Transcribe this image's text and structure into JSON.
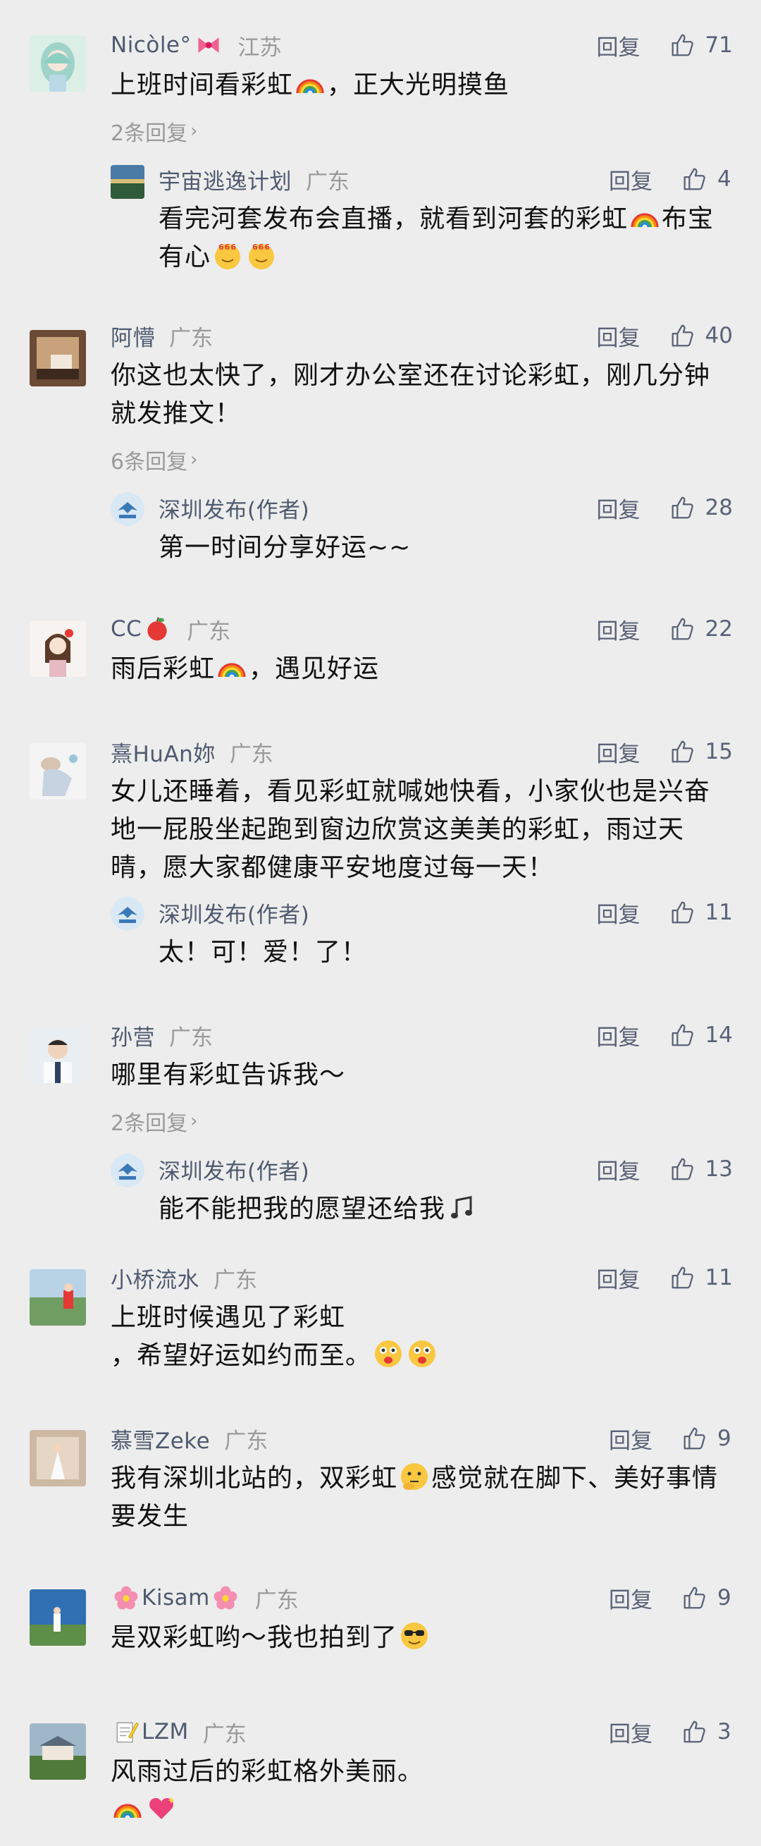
{
  "labels": {
    "reply": "回复"
  },
  "colors": {
    "background": "#ededed",
    "name": "#4f5a70",
    "meta": "#9a9a9a"
  },
  "comments": [
    {
      "name": "Nicòle°",
      "name_emoji": "bow",
      "location": "江苏",
      "likes": "71",
      "text_parts": [
        "上班时间看彩虹",
        "，正大光明摸鱼"
      ],
      "inline_emoji": [
        "rainbow"
      ],
      "more_replies": "2条回复",
      "reply": {
        "name": "宇宙逃逸计划",
        "location": "广东",
        "likes": "4",
        "text_parts": [
          "看完河套发布会直播，就看到河套的彩虹",
          "布宝有心"
        ],
        "inline_emoji": [
          "rainbow",
          "666-face",
          "666-face"
        ]
      }
    },
    {
      "name": "阿懵",
      "location": "广东",
      "likes": "40",
      "text": "你这也太快了，刚才办公室还在讨论彩虹，刚几分钟就发推文！",
      "more_replies": "6条回复",
      "reply": {
        "name": "深圳发布(作者)",
        "location": "",
        "likes": "28",
        "text": "第一时间分享好运~~"
      }
    },
    {
      "name": "CC",
      "name_emoji": "apple",
      "location": "广东",
      "likes": "22",
      "text_parts": [
        "雨后彩虹",
        "，遇见好运"
      ],
      "inline_emoji": [
        "rainbow"
      ]
    },
    {
      "name": "熹HuAn妳",
      "location": "广东",
      "likes": "15",
      "text": "女儿还睡着，看见彩虹就喊她快看，小家伙也是兴奋地一屁股坐起跑到窗边欣赏这美美的彩虹，雨过天晴，愿大家都健康平安地度过每一天！",
      "reply": {
        "name": "深圳发布(作者)",
        "location": "",
        "likes": "11",
        "text": "太！可！爱！了！"
      }
    },
    {
      "name": "孙营",
      "location": "广东",
      "likes": "14",
      "text": "哪里有彩虹告诉我～",
      "more_replies": "2条回复",
      "reply": {
        "name": "深圳发布(作者)",
        "location": "",
        "likes": "13",
        "text": "能不能把我的愿望还给我",
        "inline_emoji": [
          "music"
        ]
      }
    },
    {
      "name": "小桥流水",
      "location": "广东",
      "likes": "11",
      "text_line1": "上班时候遇见了彩虹",
      "text_line2": "，希望好运如约而至。",
      "inline_emoji": [
        "tongue-face",
        "tongue-face"
      ]
    },
    {
      "name": "慕雪Zeke",
      "location": "广东",
      "likes": "9",
      "text_parts": [
        "我有深圳北站的，双彩虹",
        "感觉就在脚下、美好事情要发生"
      ],
      "inline_emoji": [
        "thinking-face"
      ]
    },
    {
      "name_prefix_emoji": "flower",
      "name": "Kisam",
      "name_emoji": "flower",
      "location": "广东",
      "likes": "9",
      "text": "是双彩虹哟～我也拍到了",
      "inline_emoji": [
        "sunglasses-face"
      ]
    },
    {
      "name_prefix_emoji": "memo",
      "name": "LZM",
      "location": "广东",
      "likes": "3",
      "text": "风雨过后的彩虹格外美丽。",
      "inline_emoji": [
        "rainbow",
        "sparkling-heart"
      ]
    }
  ]
}
